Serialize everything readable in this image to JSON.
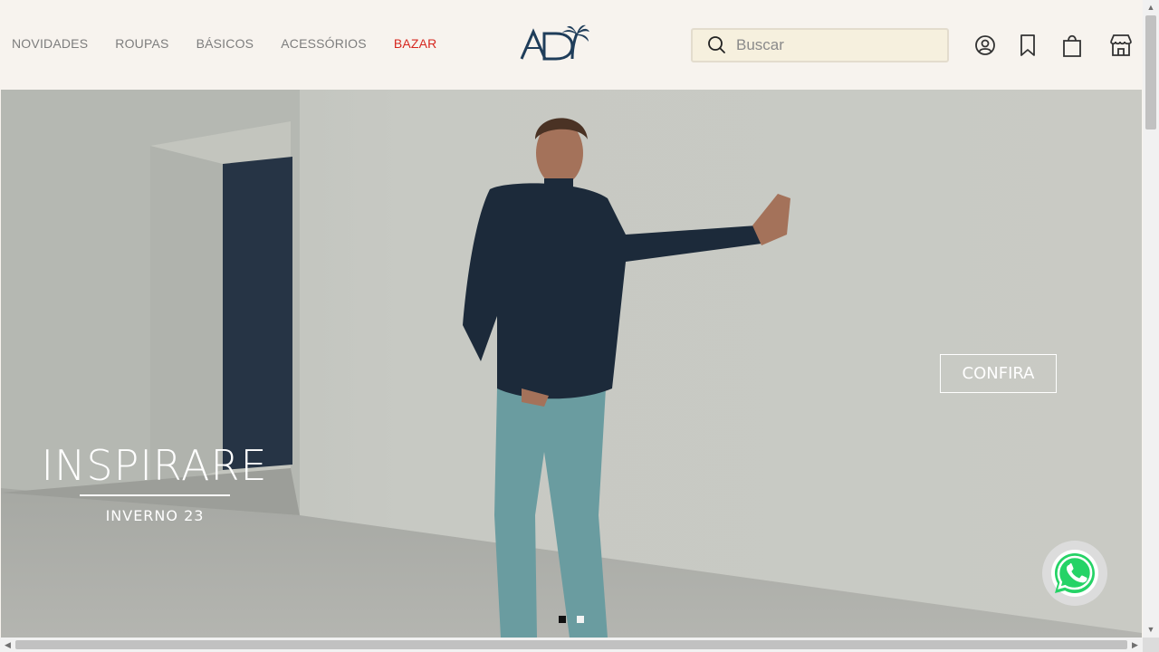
{
  "header": {
    "nav": [
      {
        "label": "NOVIDADES"
      },
      {
        "label": "ROUPAS"
      },
      {
        "label": "BÁSICOS"
      },
      {
        "label": "ACESSÓRIOS"
      },
      {
        "label": "BAZAR",
        "highlight": true
      }
    ],
    "logo_text": "AD",
    "search": {
      "placeholder": "Buscar",
      "value": ""
    },
    "icons": [
      "account-icon",
      "bookmark-icon",
      "shopping-bag-icon",
      "store-icon"
    ]
  },
  "hero": {
    "title": "INSPIRARE",
    "subtitle": "INVERNO 23",
    "cta_label": "CONFIRA",
    "slides": 2,
    "active_slide": 1
  },
  "floating": {
    "icon": "whatsapp-icon"
  },
  "colors": {
    "accent_red": "#d6271f",
    "logo_navy": "#1f3d5a",
    "search_bg": "#f6f0de",
    "header_bg": "#f7f3ee"
  }
}
